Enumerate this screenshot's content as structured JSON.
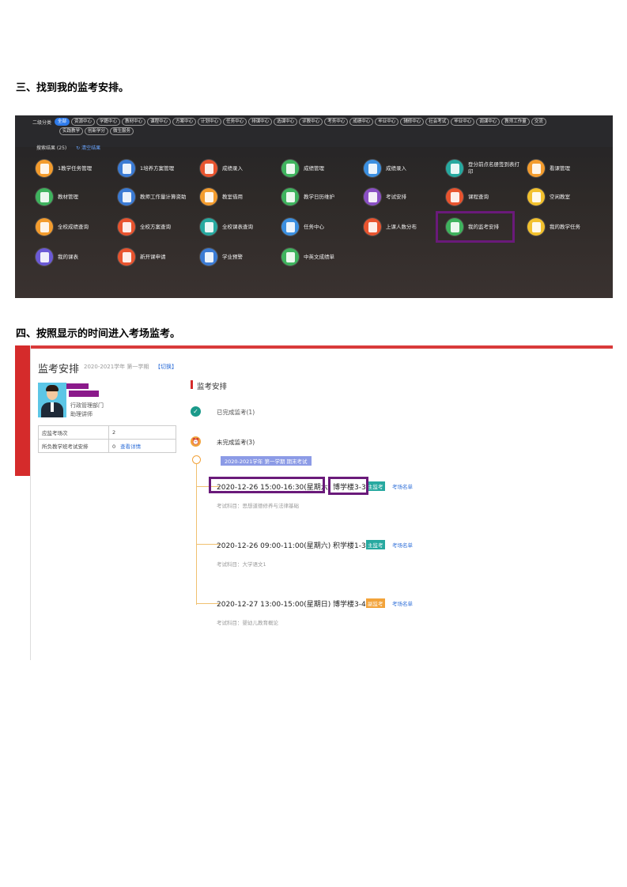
{
  "headings": {
    "step3": "三、找到我的监考安排。",
    "step4": "四、按照显示的时间进入考场监考。"
  },
  "portal": {
    "category_label": "二级分类",
    "chips_row1": [
      "全部",
      "资源中心",
      "学籍中心",
      "教材中心",
      "课程中心",
      "方案中心",
      "计划中心",
      "任务中心",
      "排课中心",
      "选课中心",
      "评教中心",
      "考务中心",
      "成绩中心",
      "毕业中心",
      "辅修中心",
      "社会考试",
      "毕业中心",
      "调课中心",
      "教师工作量",
      "交流"
    ],
    "chips_row2": [
      "实践教学",
      "创新学分",
      "微生服务"
    ],
    "search_result": "搜索结果 (25)",
    "clear_results": "清空结果",
    "apps": [
      {
        "label": "1教学任务管理",
        "color": "#f39c2e"
      },
      {
        "label": "1培养方案管理",
        "color": "#3b7bd4"
      },
      {
        "label": "成绩录入",
        "color": "#e8542f"
      },
      {
        "label": "成绩管理",
        "color": "#3fb35e"
      },
      {
        "label": "成绩录入",
        "color": "#3b8fe0"
      },
      {
        "label": "登分前点名册签到表打印",
        "color": "#27a9a0"
      },
      {
        "label": "看课管理",
        "color": "#f39c2e"
      },
      {
        "label": "教材管理",
        "color": "#3fb35e"
      },
      {
        "label": "教师工作量计算资助",
        "color": "#3b7bd4"
      },
      {
        "label": "教室借用",
        "color": "#f39c2e"
      },
      {
        "label": "教学日历维护",
        "color": "#3fb35e"
      },
      {
        "label": "考试安排",
        "color": "#8a4fc4"
      },
      {
        "label": "课程查询",
        "color": "#e8542f"
      },
      {
        "label": "空闲教室",
        "color": "#f2c12e"
      },
      {
        "label": "全校成绩查询",
        "color": "#f39c2e"
      },
      {
        "label": "全校方案查询",
        "color": "#e8542f"
      },
      {
        "label": "全校课表查询",
        "color": "#27a9a0"
      },
      {
        "label": "任务中心",
        "color": "#3b8fe0"
      },
      {
        "label": "上课人数分布",
        "color": "#e8542f"
      },
      {
        "label": "我的监考安排",
        "color": "#3fb35e"
      },
      {
        "label": "我的教学任务",
        "color": "#f2c12e"
      },
      {
        "label": "我的课表",
        "color": "#6b5ad6"
      },
      {
        "label": "新开课申请",
        "color": "#e8542f"
      },
      {
        "label": "学业预警",
        "color": "#3b7bd4"
      },
      {
        "label": "中英文成绩单",
        "color": "#3fb35e"
      }
    ]
  },
  "invigilation": {
    "title": "监考安排",
    "term": "2020-2021学年 第一学期",
    "switch_label": "【切换】",
    "profile": {
      "department": "行政管理部门",
      "role": "助理讲师"
    },
    "stats": [
      {
        "label": "应监考场次",
        "value": "2",
        "link": ""
      },
      {
        "label": "所负教学班考试安排",
        "value": "0",
        "link": "查看详情"
      }
    ],
    "section_title": "监考安排",
    "completed": "已完成监考(1)",
    "pending": "未完成监考(3)",
    "term_tag": "2020-2021学年 第一学期 期末考试",
    "exams": [
      {
        "time": "2020-12-26 15:00-16:30(星期六)",
        "room": "博学楼3-3",
        "badge": "主监考",
        "badge_color": "#27a9a0",
        "roster": "考场名单",
        "subject": "考试科目：思想道德修养与法律基础"
      },
      {
        "time": "2020-12-26 09:00-11:00(星期六)",
        "room": "积学楼1-3",
        "badge": "主监考",
        "badge_color": "#27a9a0",
        "roster": "考场名单",
        "subject": "考试科目：大学语文1"
      },
      {
        "time": "2020-12-27 13:00-15:00(星期日)",
        "room": "博学楼3-4",
        "badge": "副监考",
        "badge_color": "#f2a33a",
        "roster": "考场名单",
        "subject": "考试科目：婴幼儿教育概论"
      }
    ]
  }
}
